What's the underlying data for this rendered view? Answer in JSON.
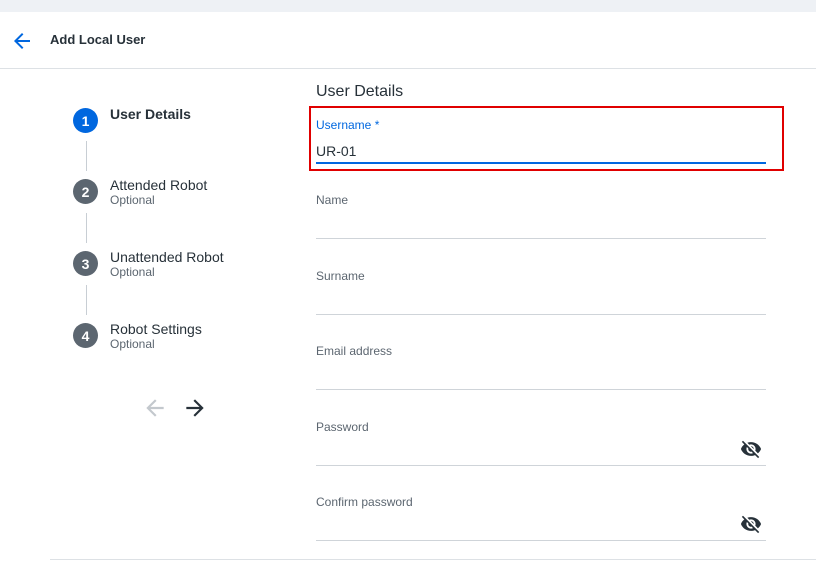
{
  "header": {
    "title": "Add Local User"
  },
  "stepper": {
    "steps": [
      {
        "number": "1",
        "label": "User Details",
        "sub": ""
      },
      {
        "number": "2",
        "label": "Attended Robot",
        "sub": "Optional"
      },
      {
        "number": "3",
        "label": "Unattended Robot",
        "sub": "Optional"
      },
      {
        "number": "4",
        "label": "Robot Settings",
        "sub": "Optional"
      }
    ]
  },
  "form": {
    "section_title": "User Details",
    "fields": {
      "username": {
        "label": "Username *",
        "value": "UR-01"
      },
      "name": {
        "label": "Name",
        "value": ""
      },
      "surname": {
        "label": "Surname",
        "value": ""
      },
      "email": {
        "label": "Email address",
        "value": ""
      },
      "password": {
        "label": "Password",
        "value": ""
      },
      "confirm_password": {
        "label": "Confirm password",
        "value": ""
      }
    }
  },
  "colors": {
    "accent": "#0067df",
    "highlight": "#e00000",
    "step_inactive": "#5c6670"
  },
  "icons": {
    "back": "arrow-left-icon",
    "prev": "arrow-left-icon",
    "next": "arrow-right-icon",
    "visibility": "eye-off-icon"
  }
}
